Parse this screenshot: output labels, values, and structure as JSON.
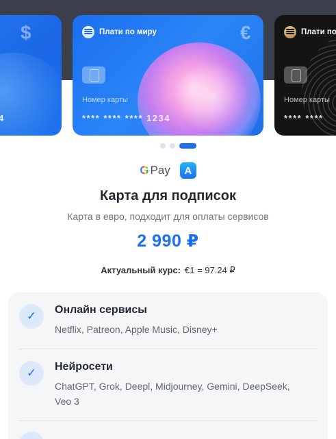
{
  "cards": {
    "left": {
      "currency": "$",
      "number_tail": "4"
    },
    "center": {
      "brand": "Плати по миру",
      "currency": "€",
      "number_label": "Номер карты",
      "number": "****  ****  ****  1234"
    },
    "right": {
      "brand": "Плати по ми",
      "number_label": "Номер карты",
      "number": "****  ****"
    }
  },
  "carousel": {
    "pages": 3,
    "active_index": 2
  },
  "payments": {
    "gpay_g": "G",
    "gpay_text": "Pay",
    "appstore_glyph": "A"
  },
  "product": {
    "title": "Карта для подписок",
    "subtitle": "Карта в евро, подходит для оплаты сервисов",
    "price": "2 990 ₽",
    "rate_label": "Актуальный курс:",
    "rate_value": "€1 = 97.24 ₽"
  },
  "features": [
    {
      "title": "Онлайн сервисы",
      "desc": "Netflix, Patreon, Apple Music, Disney+"
    },
    {
      "title": "Нейросети",
      "desc": "ChatGPT, Grok, Deepl, Midjourney, Gemini, DeepSeek, Veo 3"
    }
  ],
  "colors": {
    "accent": "#1d6ff0",
    "dark_band": "#3b3f4c"
  },
  "icons": {
    "check": "check-icon",
    "appstore": "appstore-icon"
  }
}
